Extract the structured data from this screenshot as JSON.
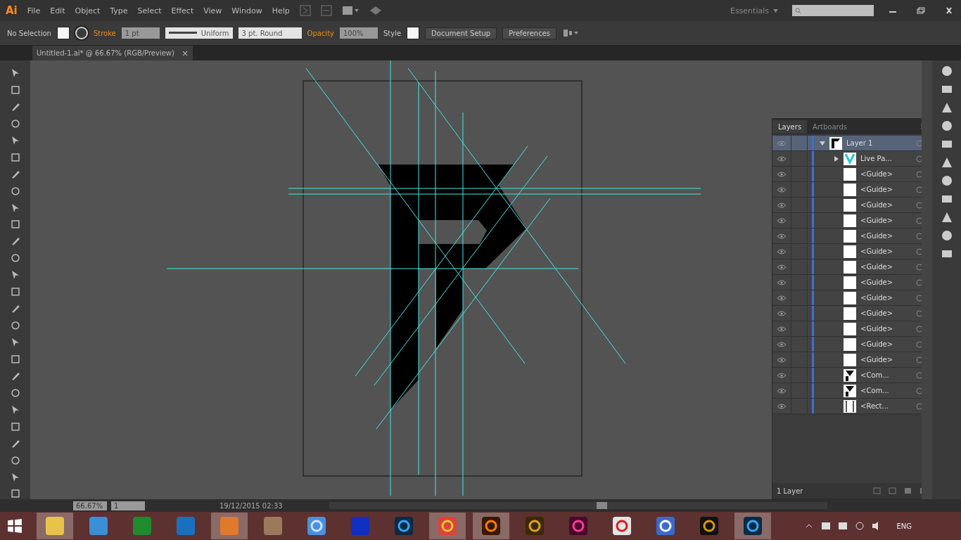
{
  "app": {
    "logo": "Ai",
    "menu": [
      "File",
      "Edit",
      "Object",
      "Type",
      "Select",
      "Effect",
      "View",
      "Window",
      "Help"
    ],
    "workspace": "Essentials"
  },
  "control_bar": {
    "selection": "No Selection",
    "stroke_label": "Stroke",
    "stroke_weight": "1 pt",
    "profile": "Uniform",
    "brush": "3 pt. Round",
    "opacity_label": "Opacity",
    "opacity": "100%",
    "style_label": "Style",
    "buttons": [
      "Document Setup",
      "Preferences"
    ]
  },
  "document_tab": {
    "title": "Untitled-1.ai* @ 66.67% (RGB/Preview)",
    "close": "×"
  },
  "layers_panel": {
    "tabs": [
      {
        "label": "Layers",
        "selected": true
      },
      {
        "label": "Artboards",
        "selected": false
      }
    ],
    "layers": [
      {
        "name": "Layer 1",
        "kind": "layer",
        "expanded": true,
        "selected": true,
        "children": [
          {
            "name": "Live Pa...",
            "kind": "group",
            "expanded": false,
            "selected": false
          },
          {
            "name": "<Guide>",
            "kind": "guide",
            "selected": false
          },
          {
            "name": "<Guide>",
            "kind": "guide",
            "selected": false
          },
          {
            "name": "<Guide>",
            "kind": "guide",
            "selected": false
          },
          {
            "name": "<Guide>",
            "kind": "guide",
            "selected": false
          },
          {
            "name": "<Guide>",
            "kind": "guide",
            "selected": false
          },
          {
            "name": "<Guide>",
            "kind": "guide",
            "selected": false
          },
          {
            "name": "<Guide>",
            "kind": "guide",
            "selected": false
          },
          {
            "name": "<Guide>",
            "kind": "guide",
            "selected": false
          },
          {
            "name": "<Guide>",
            "kind": "guide",
            "selected": false
          },
          {
            "name": "<Guide>",
            "kind": "guide",
            "selected": false
          },
          {
            "name": "<Guide>",
            "kind": "guide",
            "selected": false
          },
          {
            "name": "<Guide>",
            "kind": "guide",
            "selected": false
          },
          {
            "name": "<Guide>",
            "kind": "guide",
            "selected": false
          },
          {
            "name": "<Com...",
            "kind": "compound",
            "selected": false
          },
          {
            "name": "<Com...",
            "kind": "compound",
            "selected": false
          },
          {
            "name": "<Rect...",
            "kind": "rect",
            "selected": false
          }
        ]
      }
    ],
    "footer": "1 Layer"
  },
  "status_bar": {
    "zoom": "66.67%",
    "artboard": "1",
    "info": "19/12/2015  02:33"
  },
  "taskbar": {
    "apps": [
      {
        "kind": "folder",
        "selected": true
      },
      {
        "kind": "computer",
        "selected": false
      },
      {
        "kind": "sheet",
        "selected": false
      },
      {
        "kind": "disc",
        "selected": false
      },
      {
        "kind": "player",
        "selected": true
      },
      {
        "kind": "film",
        "selected": false
      },
      {
        "kind": "globe",
        "selected": false
      },
      {
        "kind": "k",
        "selected": false
      },
      {
        "kind": "ps",
        "selected": false
      },
      {
        "kind": "chrome",
        "selected": true
      },
      {
        "kind": "ai",
        "selected": true
      },
      {
        "kind": "br",
        "selected": false
      },
      {
        "kind": "id",
        "selected": false
      },
      {
        "kind": "lock",
        "selected": false
      },
      {
        "kind": "gear",
        "selected": false
      },
      {
        "kind": "ring",
        "selected": false
      },
      {
        "kind": "ps",
        "selected": true
      }
    ],
    "language": "ENG"
  }
}
